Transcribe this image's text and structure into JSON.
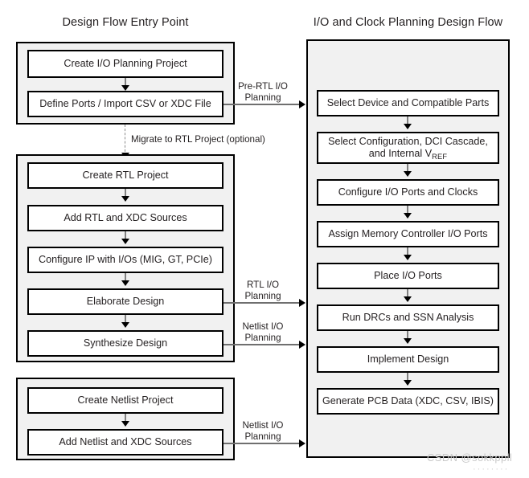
{
  "titles": {
    "left": "Design Flow Entry Point",
    "right": "I/O and Clock Planning Design Flow"
  },
  "left_flow": {
    "groups": [
      {
        "id": "pre-rtl-group",
        "nodes": [
          {
            "label": "Create I/O Planning Project"
          },
          {
            "label": "Define Ports / Import CSV or XDC File"
          }
        ]
      },
      {
        "id": "rtl-group",
        "nodes": [
          {
            "label": "Create RTL Project"
          },
          {
            "label": "Add RTL and XDC Sources"
          },
          {
            "label": "Configure IP with I/Os (MIG, GT, PCIe)"
          },
          {
            "label": "Elaborate Design"
          },
          {
            "label": "Synthesize Design"
          }
        ]
      },
      {
        "id": "netlist-group",
        "nodes": [
          {
            "label": "Create Netlist Project"
          },
          {
            "label": "Add Netlist and XDC Sources"
          }
        ]
      }
    ]
  },
  "right_flow": {
    "nodes": [
      {
        "label": "Select Device and Compatible Parts"
      },
      {
        "label_line1": "Select Configuration, DCI Cascade,",
        "label_line2_pre": "and Internal V",
        "label_line2_sub": "REF"
      },
      {
        "label": "Configure I/O Ports and Clocks"
      },
      {
        "label": "Assign Memory Controller I/O Ports"
      },
      {
        "label": "Place I/O Ports"
      },
      {
        "label": "Run DRCs and SSN Analysis"
      },
      {
        "label": "Implement Design"
      },
      {
        "label": "Generate PCB Data (XDC, CSV, IBIS)"
      }
    ]
  },
  "connectors": {
    "migrate": "Migrate to RTL Project (optional)",
    "pre_rtl_line1": "Pre-RTL I/O",
    "pre_rtl_line2": "Planning",
    "rtl_line1": "RTL I/O",
    "rtl_line2": "Planning",
    "netlist1_line1": "Netlist I/O",
    "netlist1_line2": "Planning",
    "netlist2_line1": "Netlist I/O",
    "netlist2_line2": "Planning"
  },
  "watermark": {
    "text": "CSDN @sokkppll",
    "dots": "········"
  },
  "colors": {
    "group_fill": "#f1f1f1",
    "node_fill": "#ffffff",
    "border": "#000000",
    "text": "#231f20",
    "arrow_shaft": "#808080",
    "watermark": "#c9c9c9"
  }
}
